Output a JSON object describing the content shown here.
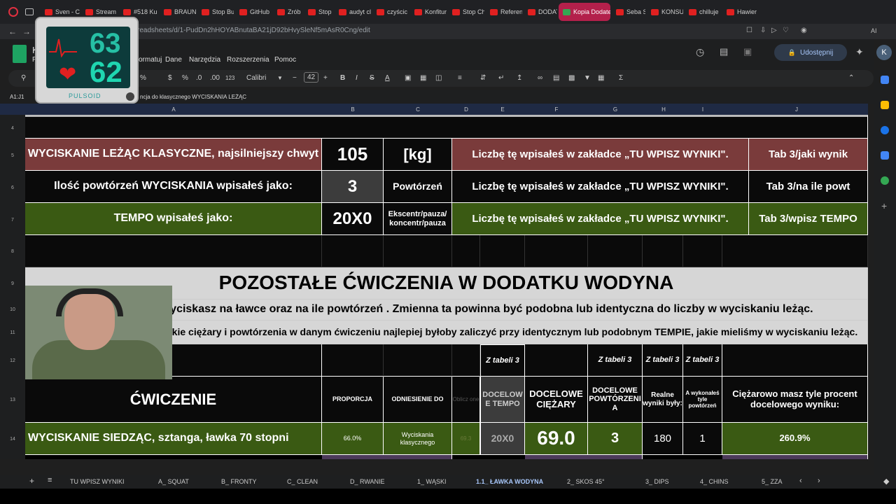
{
  "browser": {
    "tabs": [
      {
        "label": "Sven - C",
        "active": false
      },
      {
        "label": "Stream",
        "active": false
      },
      {
        "label": "#518 Ku",
        "active": false
      },
      {
        "label": "BRAUN",
        "active": false
      },
      {
        "label": "Stop Bu",
        "active": false
      },
      {
        "label": "GitHub",
        "active": false
      },
      {
        "label": "Zrób to",
        "active": false
      },
      {
        "label": "Stop Ch",
        "active": false
      },
      {
        "label": "audyt cl",
        "active": false
      },
      {
        "label": "czyścic",
        "active": false
      },
      {
        "label": "Konfitur",
        "active": false
      },
      {
        "label": "Stop Ch",
        "active": false
      },
      {
        "label": "Referen",
        "active": false
      },
      {
        "label": "DODATI",
        "active": false
      },
      {
        "label": "Kopia Dodatek",
        "active": true
      },
      {
        "label": "Seba Su",
        "active": false
      },
      {
        "label": "KONSUL",
        "active": false
      },
      {
        "label": "chilluje",
        "active": false
      },
      {
        "label": "Hawier",
        "active": false
      }
    ],
    "url": "readsheets/d/1-PudDn2hHOYABnutaBA21jD92bHvySleNf5mAsR0Cng/edit",
    "ai_label": "AI"
  },
  "sheets": {
    "title_fragment": "K",
    "menu": [
      "F",
      "ormatuj",
      "Dane",
      "Narzędzia",
      "Rozszerzenia",
      "Pomoc"
    ],
    "share_label": "Udostępnij",
    "avatar_letter": "K",
    "toolbar": {
      "percent": "%",
      "currency": "$",
      "pct2": "%",
      "dec_less": ".0",
      "dec_more": ".00",
      "num_fmt": "123",
      "font": "Calibri",
      "font_size": "42"
    },
    "cell_ref": "A1:J1",
    "formula_text": "ncja do klasycznego WYCISKANIA LEŻĄC"
  },
  "columns": [
    "A",
    "B",
    "C",
    "D",
    "E",
    "F",
    "G",
    "H",
    "I",
    "J"
  ],
  "rows": [
    "4",
    "5",
    "6",
    "7",
    "8",
    "9",
    "10",
    "11",
    "12",
    "13",
    "14"
  ],
  "grid": {
    "r5": {
      "a": "WYCISKANIE LEŻĄC KLASYCZNE, najsilniejszy chwyt",
      "b": "105",
      "c": "[kg]",
      "note": "Liczbę tę wpisałeś w zakładce „TU WPISZ WYNIKI\".",
      "j": "Tab 3/jaki wynik"
    },
    "r6": {
      "a": "Ilość powtórzeń WYCISKANIA wpisałeś jako:",
      "b": "3",
      "c": "Powtórzeń",
      "note": "Liczbę tę wpisałeś w zakładce „TU WPISZ WYNIKI\".",
      "j": "Tab 3/na ile powt"
    },
    "r7": {
      "a": "TEMPO wpisałeś jako:",
      "b": "20X0",
      "c": "Ekscentr/pauza/ koncentr/pauza",
      "note": "Liczbę tę wpisałeś w zakładce „TU WPISZ WYNIKI\".",
      "j": "Tab 3/wpisz TEMPO"
    },
    "r9": {
      "title": "POZOSTAŁE ĆWICZENIA W DODATKU WODYNA"
    },
    "r10": {
      "text": "Ćw e bazują na tym, ile wyciskasz na ławce oraz na ile powtórzeń . Zmienna ta powinna być podobna lub identyczna do liczby w wyciskaniu leżąc."
    },
    "r11": {
      "text": "wszystkie ciężary i powtórzenia w danym ćwiczeniu  najlepiej byłoby zaliczyć przy identycznym lub podobnym TEMPIE, jakie mieliśmy w wyciskaniu leżąc."
    },
    "r12": {
      "e": "Z tabeli 3",
      "g": "Z tabeli 3",
      "h": "Z tabeli 3",
      "i": "Z tabeli 3"
    },
    "r13": {
      "a": "ĆWICZENIE",
      "b": "PROPORCJA",
      "c": "ODNIESIENIE DO",
      "d": "Oblicz one",
      "e": "DOCELOW E TEMPO",
      "f": "DOCELOWE CIĘŻARY",
      "g": "DOCELOWE POWTÓRZENI A",
      "h": "Realne wyniki były:",
      "i": "A wykonałeś tyle powtórzeń",
      "j": "Ciężarowo masz tyle procent docelowego wyniku:"
    },
    "r14": {
      "a": "WYCISKANIE SIEDZĄC, sztanga, ławka 70 stopni",
      "b": "66.0%",
      "c": "Wyciskania klasycznego",
      "d": "69.3",
      "e": "20X0",
      "f": "69.0",
      "g": "3",
      "h": "180",
      "i": "1",
      "j": "260.9%"
    }
  },
  "sheet_tabs": [
    "TU WPISZ WYNIKI",
    "A_ SQUAT",
    "B_ FRONTY",
    "C_ CLEAN",
    "D_ RWANIE",
    "1_ WĄSKI",
    "1.1_ ŁAWKA WODYNA",
    "2_ SKOS 45°",
    "3_ DIPS",
    "4_ CHINS",
    "5_ ZZA"
  ],
  "active_sheet": "1.1_ ŁAWKA WODYNA",
  "overlay": {
    "bpm_top": "63",
    "bpm_bottom": "62",
    "brand": "PULSOID"
  },
  "colors": {
    "active_tab": "#b3204b",
    "red_row": "#7a3b3b",
    "green_row": "#3a5a13",
    "purple_row": "#4c3a5a",
    "accent_link": "#a8c7fa"
  }
}
